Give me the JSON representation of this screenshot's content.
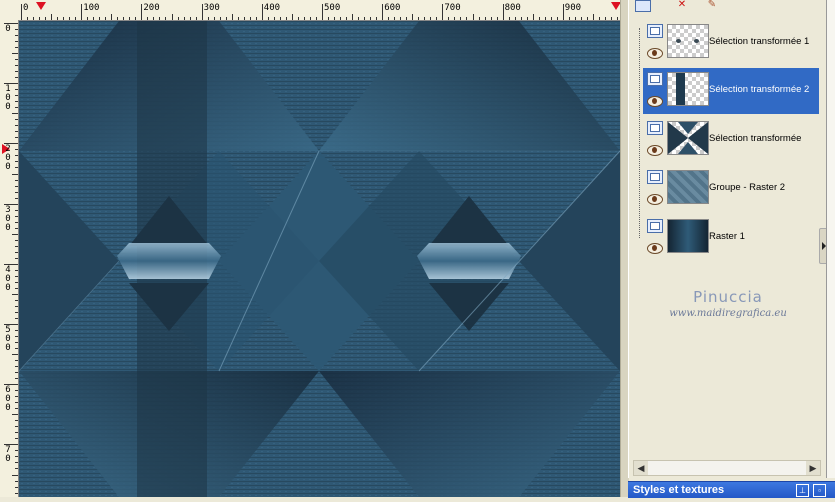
{
  "ruler": {
    "top_labels": [
      "0",
      "100",
      "200",
      "300",
      "400",
      "500",
      "600",
      "700",
      "800",
      "900"
    ],
    "left_labels": [
      [
        "0"
      ],
      [
        "1",
        "0",
        "0"
      ],
      [
        "2",
        "0",
        "0"
      ],
      [
        "3",
        "0",
        "0"
      ],
      [
        "4",
        "0",
        "0"
      ],
      [
        "5",
        "0",
        "0"
      ],
      [
        "6",
        "0",
        "0"
      ],
      [
        "7",
        "0"
      ]
    ]
  },
  "layers": [
    {
      "name": "Sélection transformée 1",
      "selected": false
    },
    {
      "name": "Sélection transformée 2",
      "selected": true
    },
    {
      "name": "Sélection transformée",
      "selected": false
    },
    {
      "name": "Groupe - Raster 2",
      "selected": false
    },
    {
      "name": "Raster 1",
      "selected": false
    }
  ],
  "watermark": {
    "title": "Pinuccia",
    "subtitle": "www.maidiregrafica.eu"
  },
  "styles_panel": {
    "title": "Styles et textures"
  },
  "icons": {
    "new_layer": "new-layer-icon",
    "delete": "delete-layer-icon",
    "edit": "edit-icon"
  },
  "colors": {
    "canvas_base": "#2b4d66",
    "selection": "#316ac5",
    "panel_bg": "#ece9d8",
    "titlebar": "#2d62d0"
  }
}
